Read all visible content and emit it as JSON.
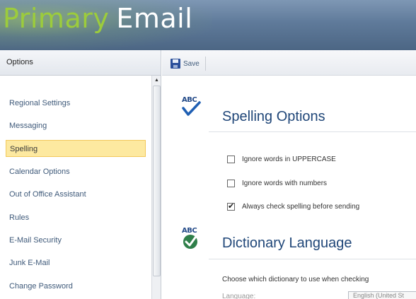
{
  "banner": {
    "word1": "Primary",
    "word2": "Email",
    "subtitle": ""
  },
  "left_pane": {
    "header": "Options",
    "items": [
      {
        "label": "Regional Settings",
        "selected": false
      },
      {
        "label": "Messaging",
        "selected": false
      },
      {
        "label": "Spelling",
        "selected": true
      },
      {
        "label": "Calendar Options",
        "selected": false
      },
      {
        "label": "Out of Office Assistant",
        "selected": false
      },
      {
        "label": "Rules",
        "selected": false
      },
      {
        "label": "E-Mail Security",
        "selected": false
      },
      {
        "label": "Junk E-Mail",
        "selected": false
      },
      {
        "label": "Change Password",
        "selected": false
      }
    ]
  },
  "toolbar": {
    "save_label": "Save"
  },
  "spelling_options": {
    "title": "Spelling Options",
    "icon_text": "ABC",
    "options": [
      {
        "label": "Ignore words in UPPERCASE",
        "checked": false
      },
      {
        "label": "Ignore words with numbers",
        "checked": false
      },
      {
        "label": "Always check spelling before sending",
        "checked": true
      }
    ]
  },
  "dictionary_language": {
    "title": "Dictionary Language",
    "icon_text": "ABC",
    "description": "Choose which dictionary to use when checking",
    "language_label": "Language:",
    "selected_language": "English (United St"
  },
  "colors": {
    "accent": "#1f4678",
    "brand_green": "#9ccc3c",
    "selection": "#fde9a0"
  }
}
